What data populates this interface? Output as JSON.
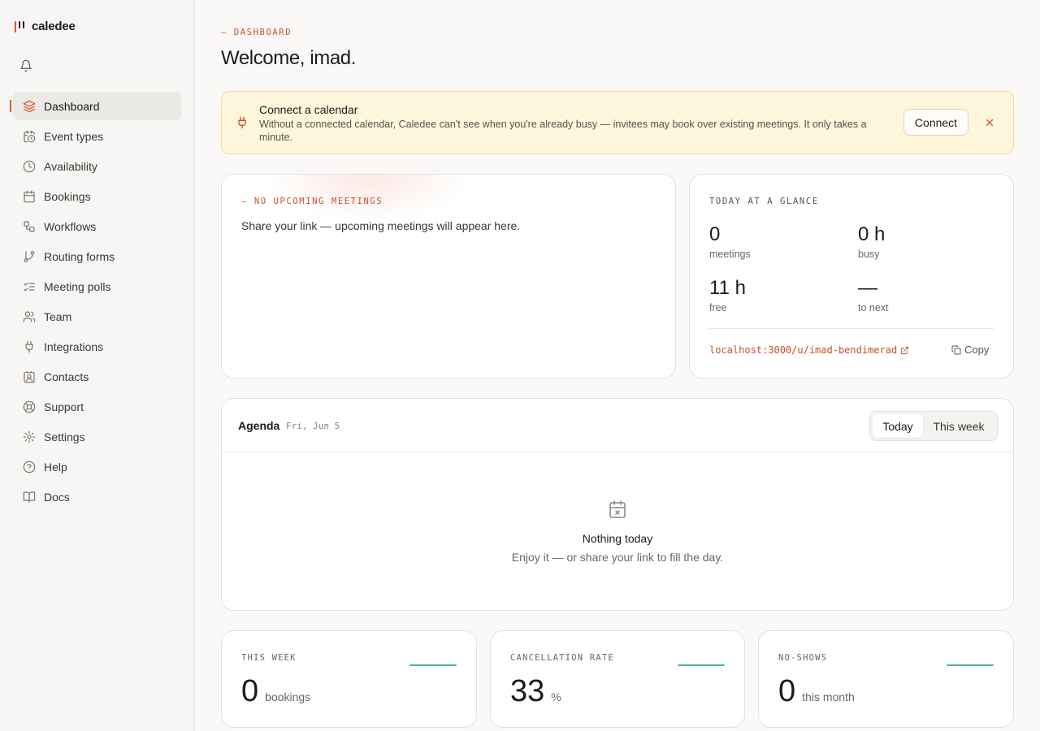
{
  "brand": {
    "name": "caledee"
  },
  "sidebar": {
    "items": [
      {
        "label": "Dashboard",
        "icon": "layers-icon",
        "active": true
      },
      {
        "label": "Event types",
        "icon": "calendar-clock-icon"
      },
      {
        "label": "Availability",
        "icon": "clock-icon"
      },
      {
        "label": "Bookings",
        "icon": "calendar-icon"
      },
      {
        "label": "Workflows",
        "icon": "workflow-icon"
      },
      {
        "label": "Routing forms",
        "icon": "git-branch-icon"
      },
      {
        "label": "Meeting polls",
        "icon": "list-checks-icon"
      },
      {
        "label": "Team",
        "icon": "users-icon"
      },
      {
        "label": "Integrations",
        "icon": "plug-icon"
      },
      {
        "label": "Contacts",
        "icon": "contact-icon"
      },
      {
        "label": "Support",
        "icon": "life-buoy-icon"
      },
      {
        "label": "Settings",
        "icon": "gear-icon"
      },
      {
        "label": "Help",
        "icon": "help-circle-icon"
      },
      {
        "label": "Docs",
        "icon": "book-open-icon"
      }
    ]
  },
  "header": {
    "eyebrow": "— DASHBOARD",
    "title": "Welcome, imad."
  },
  "banner": {
    "title": "Connect a calendar",
    "text": "Without a connected calendar, Caledee can't see when you're already busy — invitees may book over existing meetings. It only takes a minute.",
    "button": "Connect"
  },
  "upcoming": {
    "eyebrow": "— NO UPCOMING MEETINGS",
    "text": "Share your link — upcoming meetings will appear here."
  },
  "glance": {
    "eyebrow": "TODAY AT A GLANCE",
    "stats": [
      {
        "value": "0",
        "label": "meetings"
      },
      {
        "value": "0 h",
        "label": "busy"
      },
      {
        "value": "11 h",
        "label": "free"
      },
      {
        "value": "—",
        "label": "to next"
      }
    ],
    "link": "localhost:3000/u/imad-bendimerad",
    "copy": "Copy"
  },
  "agenda": {
    "title": "Agenda",
    "date": "Fri, Jun 5",
    "tabs": [
      "Today",
      "This week"
    ],
    "empty_title": "Nothing today",
    "empty_sub": "Enjoy it — or share your link to fill the day."
  },
  "metrics": [
    {
      "label": "THIS WEEK",
      "value": "0",
      "unit": "bookings"
    },
    {
      "label": "CANCELLATION RATE",
      "value": "33",
      "unit": "%"
    },
    {
      "label": "NO-SHOWS",
      "value": "0",
      "unit": "this month"
    }
  ],
  "colors": {
    "accent": "#d4572a",
    "sparkline": "#4fb3a3",
    "banner_bg": "#fdf6dc"
  }
}
